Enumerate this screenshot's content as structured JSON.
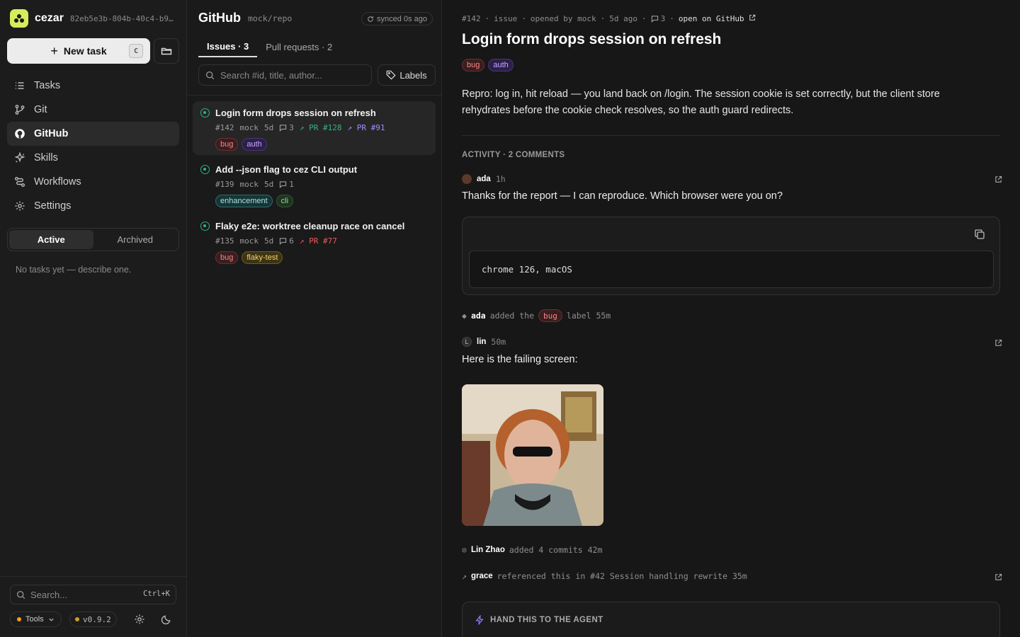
{
  "app": {
    "name": "cezar",
    "instance_id": "82eb5e3b-804b-40c4-b9…"
  },
  "sidebar": {
    "new_task": "New task",
    "new_task_key": "C",
    "items": [
      {
        "label": "Tasks",
        "icon": "list-icon"
      },
      {
        "label": "Git",
        "icon": "git-branch-icon"
      },
      {
        "label": "GitHub",
        "icon": "github-icon",
        "active": true
      },
      {
        "label": "Skills",
        "icon": "sparkle-icon"
      },
      {
        "label": "Workflows",
        "icon": "workflow-icon"
      },
      {
        "label": "Settings",
        "icon": "gear-icon"
      }
    ],
    "segment": {
      "active": "Active",
      "archived": "Archived"
    },
    "empty": "No tasks yet — describe one.",
    "search_placeholder": "Search...",
    "search_key": "Ctrl+K",
    "tools": "Tools",
    "version": "v0.9.2"
  },
  "list": {
    "title": "GitHub",
    "repo": "mock/repo",
    "synced": "synced 0s ago",
    "tabs": {
      "issues": "Issues · 3",
      "prs": "Pull requests · 2"
    },
    "search_placeholder": "Search #id, title, author...",
    "labels_button": "Labels",
    "issues": [
      {
        "title": "Login form drops session on refresh",
        "num": "#142",
        "author": "mock",
        "age": "5d",
        "comments": "3",
        "pr1": "PR #128",
        "pr2": "PR #91",
        "labels": [
          "bug",
          "auth"
        ]
      },
      {
        "title": "Add --json flag to cez CLI output",
        "num": "#139",
        "author": "mock",
        "age": "5d",
        "comments": "1",
        "labels": [
          "enhancement",
          "cli"
        ]
      },
      {
        "title": "Flaky e2e: worktree cleanup race on cancel",
        "num": "#135",
        "author": "mock",
        "age": "5d",
        "comments": "6",
        "pr1": "PR #77",
        "labels": [
          "bug",
          "flaky-test"
        ]
      }
    ]
  },
  "detail": {
    "meta": {
      "num": "#142",
      "type": "issue",
      "opened": "opened by mock",
      "age": "5d ago",
      "comments": "3",
      "link": "open on GitHub"
    },
    "title": "Login form drops session on refresh",
    "labels": [
      "bug",
      "auth"
    ],
    "body": "Repro: log in, hit reload — you land back on /login. The session cookie is set correctly, but the client store rehydrates before the cookie check resolves, so the auth guard redirects.",
    "activity_header": "ACTIVITY · 2 COMMENTS",
    "comment1": {
      "user": "ada",
      "time": "1h",
      "text": "Thanks for the report — I can reproduce. Which browser were you on?",
      "code": "chrome 126, macOS"
    },
    "event1": {
      "user": "ada",
      "pre": "added the",
      "label": "bug",
      "post": "label 55m"
    },
    "comment2": {
      "user": "lin",
      "avatar": "L",
      "time": "50m",
      "text": "Here is the failing screen:"
    },
    "event2": {
      "user": "Lin Zhao",
      "text": "added 4 commits 42m"
    },
    "event3": {
      "user": "grace",
      "text": "referenced this in #42 Session handling rewrite 35m"
    },
    "handoff": "HAND THIS TO THE AGENT"
  }
}
